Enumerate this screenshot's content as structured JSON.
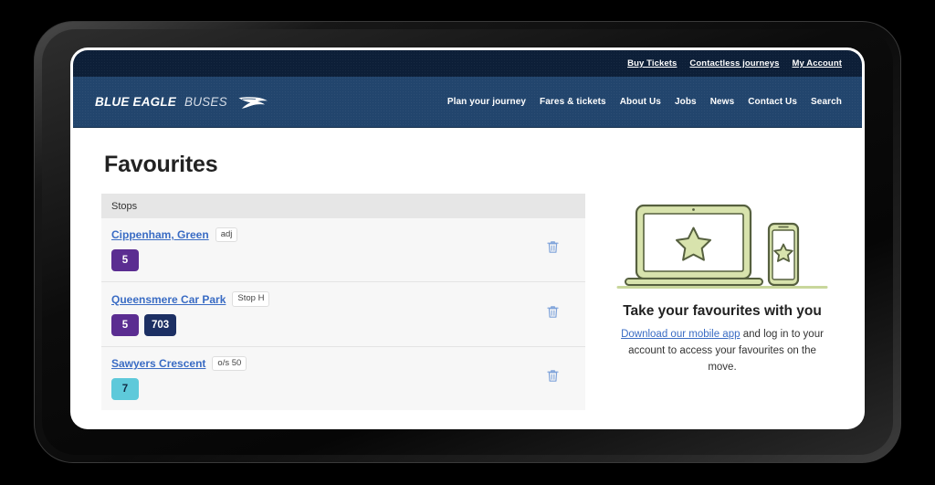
{
  "header": {
    "topbar_links": [
      {
        "label": "Buy Tickets"
      },
      {
        "label": "Contactless journeys"
      },
      {
        "label": "My Account"
      }
    ],
    "logo": {
      "primary": "BLUE EAGLE",
      "secondary": "BUSES",
      "icon": "eagle-wing-icon"
    },
    "nav_links": [
      {
        "label": "Plan your journey"
      },
      {
        "label": "Fares & tickets"
      },
      {
        "label": "About Us"
      },
      {
        "label": "Jobs"
      },
      {
        "label": "News"
      },
      {
        "label": "Contact Us"
      },
      {
        "label": "Search"
      }
    ]
  },
  "page": {
    "title": "Favourites"
  },
  "favourites": {
    "column_header": "Stops",
    "delete_icon": "trash-icon",
    "rows": [
      {
        "stop_name": "Cippenham, Green",
        "stop_tag": "adj",
        "routes": [
          {
            "number": "5",
            "bg": "#5b2d91",
            "fg": "#ffffff"
          }
        ]
      },
      {
        "stop_name": "Queensmere Car Park",
        "stop_tag": "Stop H",
        "routes": [
          {
            "number": "5",
            "bg": "#5b2d91",
            "fg": "#ffffff"
          },
          {
            "number": "703",
            "bg": "#1c2f63",
            "fg": "#ffffff"
          }
        ]
      },
      {
        "stop_name": "Sawyers Crescent",
        "stop_tag": "o/s 50",
        "routes": [
          {
            "number": "7",
            "bg": "#5ec9da",
            "fg": "#102a43"
          }
        ]
      }
    ]
  },
  "promo": {
    "illustration": "laptop-and-phone-with-star-icon",
    "title": "Take your favourites with you",
    "link_text": "Download our mobile app",
    "body_text": " and log in to your account to access your favourites on the move."
  },
  "colors": {
    "topbar_bg": "#0d1f38",
    "header_bg": "#22456d",
    "link_blue": "#3a6cc4",
    "table_header_bg": "#e6e6e6",
    "row_bg": "#f7f7f7",
    "illustration_green": "#cfdda0",
    "illustration_outline": "#4a5340"
  }
}
